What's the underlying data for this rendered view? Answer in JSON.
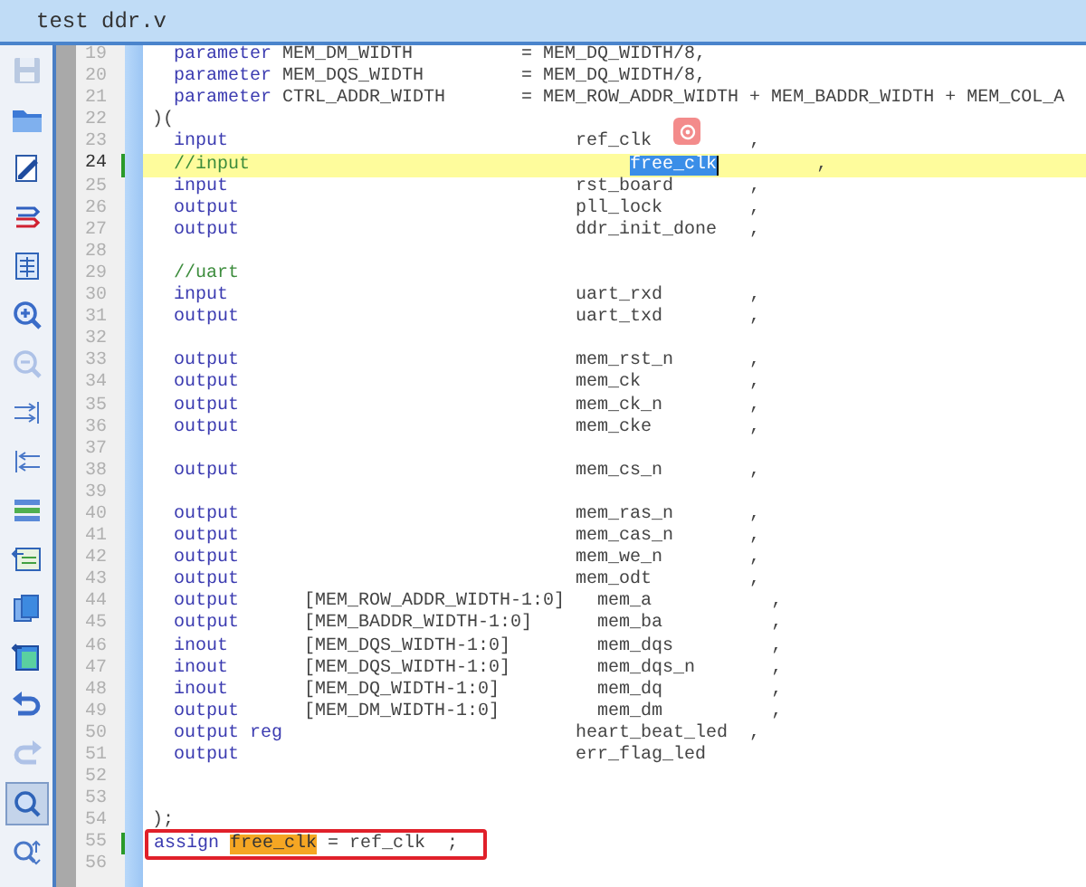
{
  "window": {
    "title": "test ddr.v"
  },
  "toolbar": [
    {
      "kind": "save",
      "disabled": true,
      "pressed": false
    },
    {
      "kind": "open",
      "disabled": false,
      "pressed": false
    },
    {
      "kind": "edit",
      "disabled": false,
      "pressed": false
    },
    {
      "kind": "lines",
      "disabled": false,
      "pressed": false
    },
    {
      "kind": "document",
      "disabled": false,
      "pressed": false
    },
    {
      "kind": "zoom-in",
      "disabled": false,
      "pressed": false
    },
    {
      "kind": "zoom-out",
      "disabled": true,
      "pressed": false
    },
    {
      "kind": "indent",
      "disabled": false,
      "pressed": false
    },
    {
      "kind": "outdent",
      "disabled": false,
      "pressed": false
    },
    {
      "kind": "list",
      "disabled": false,
      "pressed": false
    },
    {
      "kind": "import",
      "disabled": false,
      "pressed": false
    },
    {
      "kind": "copy",
      "disabled": false,
      "pressed": false
    },
    {
      "kind": "paste",
      "disabled": false,
      "pressed": false
    },
    {
      "kind": "undo",
      "disabled": false,
      "pressed": false
    },
    {
      "kind": "redo",
      "disabled": true,
      "pressed": false
    },
    {
      "kind": "find",
      "disabled": false,
      "pressed": true
    },
    {
      "kind": "replace",
      "disabled": false,
      "pressed": false
    }
  ],
  "lines": [
    {
      "number": "19",
      "tokens": [
        {
          "kind": "keyword",
          "text": "  parameter"
        },
        {
          "kind": "plain",
          "text": " MEM_DM_WIDTH          = MEM_DQ_WIDTH/8,"
        }
      ]
    },
    {
      "number": "20",
      "tokens": [
        {
          "kind": "keyword",
          "text": "  parameter"
        },
        {
          "kind": "plain",
          "text": " MEM_DQS_WIDTH         = MEM_DQ_WIDTH/8,"
        }
      ]
    },
    {
      "number": "21",
      "tokens": [
        {
          "kind": "keyword",
          "text": "  parameter"
        },
        {
          "kind": "plain",
          "text": " CTRL_ADDR_WIDTH       = MEM_ROW_ADDR_WIDTH + MEM_BADDR_WIDTH + MEM_COL_A"
        }
      ]
    },
    {
      "number": "22",
      "tokens": [
        {
          "kind": "plain",
          "text": ")("
        }
      ]
    },
    {
      "number": "23",
      "tokens": [
        {
          "kind": "keyword",
          "text": "  input"
        },
        {
          "kind": "plain",
          "text": "                                ref_clk         ,"
        }
      ]
    },
    {
      "number": "24",
      "current": true,
      "changed": true,
      "tokens": [
        {
          "kind": "comment",
          "text": "  //input                                   "
        },
        {
          "kind": "selection",
          "text": "free_clk"
        },
        {
          "kind": "plain",
          "text": "         ,"
        }
      ]
    },
    {
      "number": "25",
      "tokens": [
        {
          "kind": "keyword",
          "text": "  input"
        },
        {
          "kind": "plain",
          "text": "                                rst_board       ,"
        }
      ]
    },
    {
      "number": "26",
      "tokens": [
        {
          "kind": "keyword",
          "text": "  output"
        },
        {
          "kind": "plain",
          "text": "                               pll_lock        ,"
        }
      ]
    },
    {
      "number": "27",
      "tokens": [
        {
          "kind": "keyword",
          "text": "  output"
        },
        {
          "kind": "plain",
          "text": "                               ddr_init_done   ,"
        }
      ]
    },
    {
      "number": "28"
    },
    {
      "number": "29",
      "tokens": [
        {
          "kind": "comment",
          "text": "  //uart"
        }
      ]
    },
    {
      "number": "30",
      "tokens": [
        {
          "kind": "keyword",
          "text": "  input"
        },
        {
          "kind": "plain",
          "text": "                                uart_rxd        ,"
        }
      ]
    },
    {
      "number": "31",
      "tokens": [
        {
          "kind": "keyword",
          "text": "  output"
        },
        {
          "kind": "plain",
          "text": "                               uart_txd        ,"
        }
      ]
    },
    {
      "number": "32"
    },
    {
      "number": "33",
      "tokens": [
        {
          "kind": "keyword",
          "text": "  output"
        },
        {
          "kind": "plain",
          "text": "                               mem_rst_n       ,"
        }
      ]
    },
    {
      "number": "34",
      "tokens": [
        {
          "kind": "keyword",
          "text": "  output"
        },
        {
          "kind": "plain",
          "text": "                               mem_ck          ,"
        }
      ]
    },
    {
      "number": "35",
      "tokens": [
        {
          "kind": "keyword",
          "text": "  output"
        },
        {
          "kind": "plain",
          "text": "                               mem_ck_n        ,"
        }
      ]
    },
    {
      "number": "36",
      "tokens": [
        {
          "kind": "keyword",
          "text": "  output"
        },
        {
          "kind": "plain",
          "text": "                               mem_cke         ,"
        }
      ]
    },
    {
      "number": "37"
    },
    {
      "number": "38",
      "tokens": [
        {
          "kind": "keyword",
          "text": "  output"
        },
        {
          "kind": "plain",
          "text": "                               mem_cs_n        ,"
        }
      ]
    },
    {
      "number": "39"
    },
    {
      "number": "40",
      "tokens": [
        {
          "kind": "keyword",
          "text": "  output"
        },
        {
          "kind": "plain",
          "text": "                               mem_ras_n       ,"
        }
      ]
    },
    {
      "number": "41",
      "tokens": [
        {
          "kind": "keyword",
          "text": "  output"
        },
        {
          "kind": "plain",
          "text": "                               mem_cas_n       ,"
        }
      ]
    },
    {
      "number": "42",
      "tokens": [
        {
          "kind": "keyword",
          "text": "  output"
        },
        {
          "kind": "plain",
          "text": "                               mem_we_n        ,"
        }
      ]
    },
    {
      "number": "43",
      "tokens": [
        {
          "kind": "keyword",
          "text": "  output"
        },
        {
          "kind": "plain",
          "text": "                               mem_odt         ,"
        }
      ]
    },
    {
      "number": "44",
      "tokens": [
        {
          "kind": "keyword",
          "text": "  output"
        },
        {
          "kind": "plain",
          "text": "      [MEM_ROW_ADDR_WIDTH-1:0]   mem_a           ,"
        }
      ]
    },
    {
      "number": "45",
      "tokens": [
        {
          "kind": "keyword",
          "text": "  output"
        },
        {
          "kind": "plain",
          "text": "      [MEM_BADDR_WIDTH-1:0]      mem_ba          ,"
        }
      ]
    },
    {
      "number": "46",
      "tokens": [
        {
          "kind": "keyword",
          "text": "  inout"
        },
        {
          "kind": "plain",
          "text": "       [MEM_DQS_WIDTH-1:0]        mem_dqs         ,"
        }
      ]
    },
    {
      "number": "47",
      "tokens": [
        {
          "kind": "keyword",
          "text": "  inout"
        },
        {
          "kind": "plain",
          "text": "       [MEM_DQS_WIDTH-1:0]        mem_dqs_n       ,"
        }
      ]
    },
    {
      "number": "48",
      "tokens": [
        {
          "kind": "keyword",
          "text": "  inout"
        },
        {
          "kind": "plain",
          "text": "       [MEM_DQ_WIDTH-1:0]         mem_dq          ,"
        }
      ]
    },
    {
      "number": "49",
      "tokens": [
        {
          "kind": "keyword",
          "text": "  output"
        },
        {
          "kind": "plain",
          "text": "      [MEM_DM_WIDTH-1:0]         mem_dm          ,"
        }
      ]
    },
    {
      "number": "50",
      "tokens": [
        {
          "kind": "keyword",
          "text": "  output reg"
        },
        {
          "kind": "plain",
          "text": "                           heart_beat_led  ,"
        }
      ]
    },
    {
      "number": "51",
      "tokens": [
        {
          "kind": "keyword",
          "text": "  output"
        },
        {
          "kind": "plain",
          "text": "                               err_flag_led"
        }
      ]
    },
    {
      "number": "52"
    },
    {
      "number": "53"
    },
    {
      "number": "54",
      "tokens": [
        {
          "kind": "plain",
          "text": ");"
        }
      ]
    },
    {
      "number": "55",
      "changed": true,
      "boxed": true,
      "tokens": [
        {
          "kind": "keyword",
          "text": "assign "
        },
        {
          "kind": "match",
          "text": "free_clk"
        },
        {
          "kind": "plain",
          "text": " = ref_clk  ;"
        }
      ]
    },
    {
      "number": "56"
    }
  ]
}
